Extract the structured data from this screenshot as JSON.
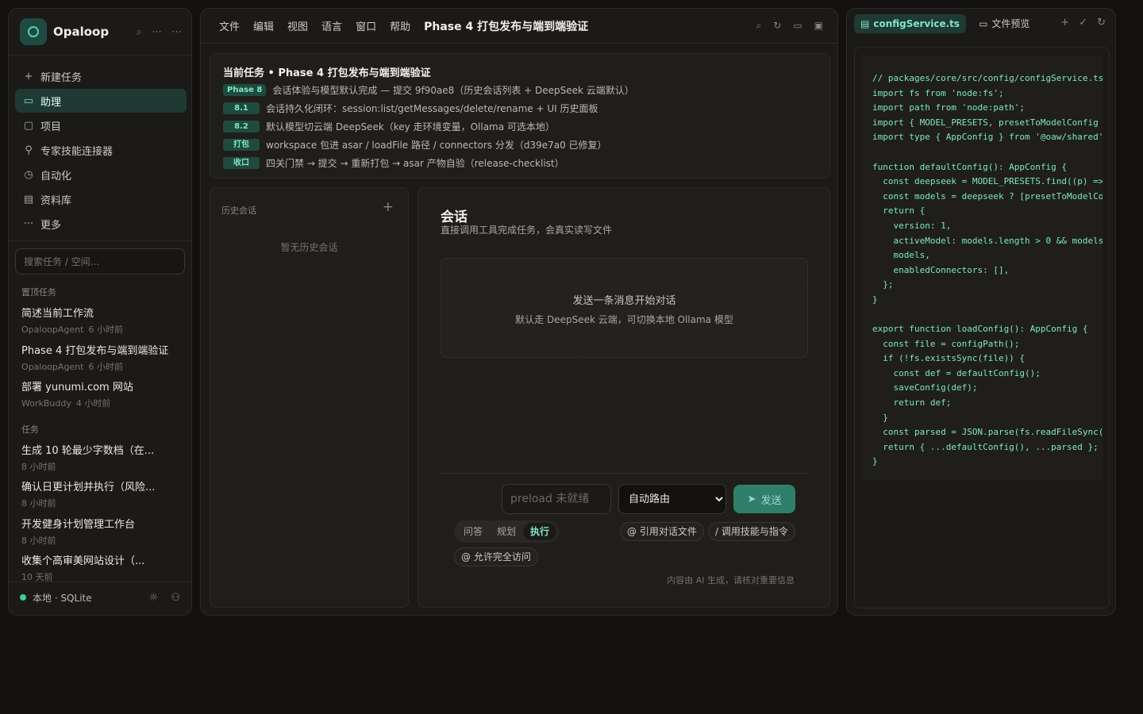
{
  "sidebar": {
    "brand": "Opaloop",
    "nav": [
      {
        "label": "新建任务",
        "icon": "+"
      },
      {
        "label": "助理",
        "icon": "▭"
      },
      {
        "label": "项目",
        "icon": "▢"
      },
      {
        "label": "专家技能连接器",
        "icon": "⚲"
      },
      {
        "label": "自动化",
        "icon": "◷"
      },
      {
        "label": "资料库",
        "icon": "▤"
      },
      {
        "label": "更多",
        "icon": "···"
      }
    ],
    "search_placeholder": "搜索任务 / 空间...",
    "pinned_title": "置顶任务",
    "pinned": [
      {
        "title": "简述当前工作流",
        "source": "OpaloopAgent",
        "time": "6 小时前"
      },
      {
        "title": "Phase 4 打包发布与端到端验证",
        "source": "OpaloopAgent",
        "time": "6 小时前"
      },
      {
        "title": "部署 yunumi.com 网站",
        "source": "WorkBuddy",
        "time": "4 小时前"
      }
    ],
    "tasks_title": "任务",
    "tasks": [
      {
        "title": "生成 10 轮最少字数档（在...",
        "time": "8 小时前"
      },
      {
        "title": "确认日更计划并执行（风险...",
        "time": "8 小时前"
      },
      {
        "title": "开发健身计划管理工作台",
        "time": "8 小时前"
      },
      {
        "title": "收集个高审美网站设计（...",
        "time": "10 天前"
      }
    ],
    "footer_status": "本地 · SQLite"
  },
  "menubar": {
    "items": [
      "文件",
      "编辑",
      "视图",
      "语言",
      "窗口",
      "帮助"
    ],
    "title": "Phase 4 打包发布与端到端验证"
  },
  "task_card": {
    "title": "当前任务 • Phase 4 打包发布与端到端验证",
    "rows": [
      {
        "badge": "Phase 8",
        "text": "会话体验与模型默认完成 — 提交 9f90ae8（历史会话列表 + DeepSeek 云端默认）"
      },
      {
        "badge": "8.1",
        "text": "会话持久化闭环：session:list/getMessages/delete/rename + UI 历史面板"
      },
      {
        "badge": "8.2",
        "text": "默认模型切云端 DeepSeek（key 走环境变量，Ollama 可选本地）"
      },
      {
        "badge": "打包",
        "text": "workspace 包进 asar / loadFile 路径 / connectors 分发（d39e7a0 已修复）"
      },
      {
        "badge": "收口",
        "text": "四关门禁 → 提交 → 重新打包 → asar 产物自验（release-checklist）"
      }
    ]
  },
  "history": {
    "title": "历史会话",
    "empty": "暂无历史会话"
  },
  "chat": {
    "title": "会话",
    "subtitle": "直接调用工具完成任务，会真实读写文件",
    "empty_line1": "发送一条消息开始对话",
    "empty_line2": "默认走 DeepSeek 云端，可切换本地 Ollama 模型",
    "preload_placeholder": "preload 未就绪",
    "route_selected": "自动路由",
    "send_label": "发送",
    "modes": [
      "问答",
      "规划",
      "执行"
    ],
    "active_mode": "执行",
    "chip_ref": "@ 引用对话文件",
    "chip_skill": "/ 调用技能与指令",
    "chip_access": "@ 允许完全访问",
    "disclaimer": "内容由 AI 生成，请核对重要信息"
  },
  "right_panel": {
    "tab_code": "configService.ts",
    "tab_preview": "文件预览",
    "code": "// packages/core/src/config/configService.ts\nimport fs from 'node:fs';\nimport path from 'node:path';\nimport { MODEL_PRESETS, presetToModelConfig } from './presets';\nimport type { AppConfig } from '@oaw/shared';\n\nfunction defaultConfig(): AppConfig {\n  const deepseek = MODEL_PRESETS.find((p) => p.id === 'deepseek');\n  const models = deepseek ? [presetToModelConfig(deepseek)] : [];\n  return {\n    version: 1,\n    activeModel: models.length > 0 && models[0].id,\n    models,\n    enabledConnectors: [],\n  };\n}\n\nexport function loadConfig(): AppConfig {\n  const file = configPath();\n  if (!fs.existsSync(file)) {\n    const def = defaultConfig();\n    saveConfig(def);\n    return def;\n  }\n  const parsed = JSON.parse(fs.readFileSync(file, 'utf8'));\n  return { ...defaultConfig(), ...parsed };\n}"
  },
  "colors": {
    "accent": "#4fd1b0",
    "accent_bg": "#1e3a33",
    "send_bg": "#2f7f6b",
    "status_dot": "#3ecf8e"
  }
}
